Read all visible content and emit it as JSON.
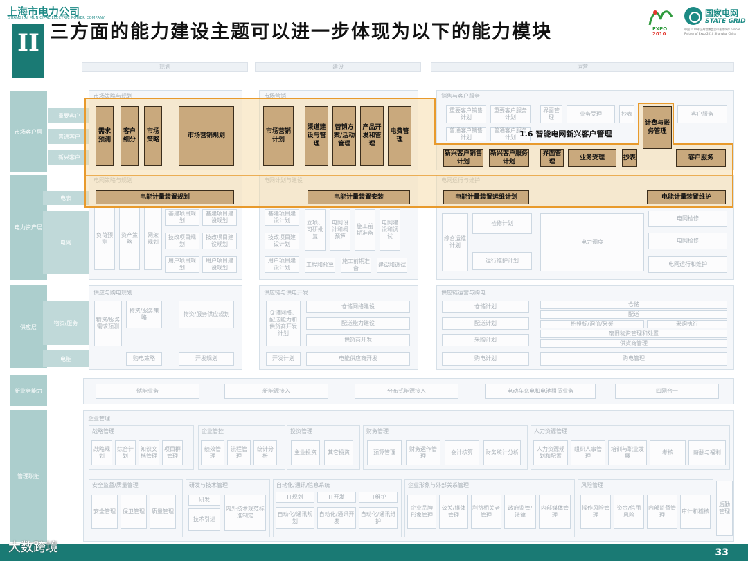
{
  "header": {
    "company_cn": "上海市电力公司",
    "company_en": "SHANGHAI MUNICIPAL ELECTRIC POWER COMPANY",
    "section_numeral": "II",
    "title": "三方面的能力建设主题可以进一步体现为以下的能力模块",
    "expo_logo_text": "EXPO 2010",
    "grid_logo_cn": "国家电网",
    "grid_logo_en": "STATE GRID",
    "grid_logo_small": "中国2010年上海世博会全球合作伙伴 Global Partner of Expo 2010 Shanghai China"
  },
  "diagram": {
    "stages": [
      "规划",
      "建设",
      "运营"
    ],
    "rows": [
      {
        "label": "市场客户层"
      },
      {
        "label": "电力资产层"
      },
      {
        "label": "供应层"
      },
      {
        "label": "新业务能力"
      },
      {
        "label": "管理职能"
      }
    ],
    "sub_rows": [
      "重要客户",
      "普通客户",
      "新兴客户",
      "电表",
      "电网",
      "物资/服务",
      "电能"
    ],
    "faded_boxes": [
      "重要客户销售计划",
      "重要客户服务计划",
      "界面管理",
      "业务受理",
      "抄表",
      "客户服务",
      "普通客户销售计划",
      "普通客户服务计划",
      "基建项目规划",
      "基建项目建设规划",
      "技改项目规划",
      "技改项目建设规划",
      "用户项目规划",
      "用户项目建设规划",
      "负荷预测",
      "资产策略",
      "网架规划",
      "基建项目建设计划",
      "技改项目建设计划",
      "用户项目建设计划",
      "立项、可研批复",
      "电网设计和概预算",
      "施工前期准备",
      "电网建设和调试",
      "工程和预算",
      "施工前期准备",
      "建设和调试",
      "综合运维计划",
      "检修计划",
      "运行维护计划",
      "电力调度",
      "电网检修",
      "电网检修",
      "电网运行和维护",
      "物资/服务需求预测",
      "物资/服务策略",
      "物资/服务供应规划",
      "购电策略",
      "开发规划",
      "仓储网络建设",
      "配送能力建设",
      "供货商开发",
      "电能供应商开发",
      "仓储网络、配送能力和供货商开发计划",
      "开发计划",
      "仓储计划",
      "配送计划",
      "采购计划",
      "购电计划",
      "仓储",
      "配送",
      "招投标/询价/采买",
      "采购执行",
      "废旧物资管理和处置",
      "供货商管理",
      "购电管理",
      "储能业务",
      "新能源接入",
      "分布式能源接入",
      "电动车充电和电池租赁业务",
      "四网合一",
      "企业管理",
      "战略管理",
      "战略规划",
      "综合计划",
      "知识文档管理",
      "项目群管理",
      "企业管控",
      "绩效管理",
      "流程管理",
      "统计分析",
      "投资管理",
      "主业投资",
      "其它投资",
      "财务管理",
      "预算管理",
      "财务运作管理",
      "会计核算",
      "财务统计分析",
      "人力资源管理",
      "人力资源规划和配置",
      "组织人事管理",
      "培训与职业发展",
      "考核",
      "薪酬与福利",
      "安全监督/质量管理",
      "安全管理",
      "保卫管理",
      "质量管理",
      "研发与技术管理",
      "研发",
      "技术引进",
      "内外技术规范标准制定",
      "自动化/通讯/信息系统",
      "IT规划",
      "IT开发",
      "IT维护",
      "自动化/通讯规划",
      "自动化/通讯开发",
      "自动化/通讯维护",
      "企业形象与外部关系管理",
      "企业品牌形象管理",
      "公关/媒体管理",
      "利益相关者管理",
      "政府监管/法律",
      "内部媒体管理",
      "风险管理",
      "操作风险管理",
      "资金/信用风险",
      "内部监督管理",
      "审计和稽核",
      "后勤管理"
    ],
    "panel_heads": [
      "市场策略与规划",
      "市场营销",
      "销售与客户服务",
      "电网策略与规划",
      "电网计划与建设",
      "电网运行与维护",
      "供应与购电规划",
      "供应链与供电开发",
      "供应链运营与购电"
    ]
  },
  "highlight": {
    "planning_items": [
      "需求预测",
      "客户细分",
      "市场策略",
      "市场营销规划"
    ],
    "construction_items": [
      "市场营销计划",
      "渠道建设与管理",
      "营销方案/活动管理",
      "产品开发和管理",
      "电费管理"
    ],
    "operation_top_items": [
      "计费与帐务管理"
    ],
    "operation_items": [
      "新兴客户销售计划",
      "新兴客户服务计划",
      "界面管理",
      "业务受理",
      "抄表",
      "客户服务"
    ],
    "meter_items": [
      "电能计量装置规划",
      "电能计量装置安装",
      "电能计量装置运维计划",
      "电能计量装置维护"
    ],
    "callout": "1.6 智能电网新兴客户管理"
  },
  "footer": {
    "page_number": "33",
    "watermark": "大数跨境"
  },
  "colors": {
    "teal": "#1a7a74",
    "orange_fill": "#f6d9a3",
    "orange_stroke": "#e89a2c",
    "box_fill": "#c9a97d"
  }
}
